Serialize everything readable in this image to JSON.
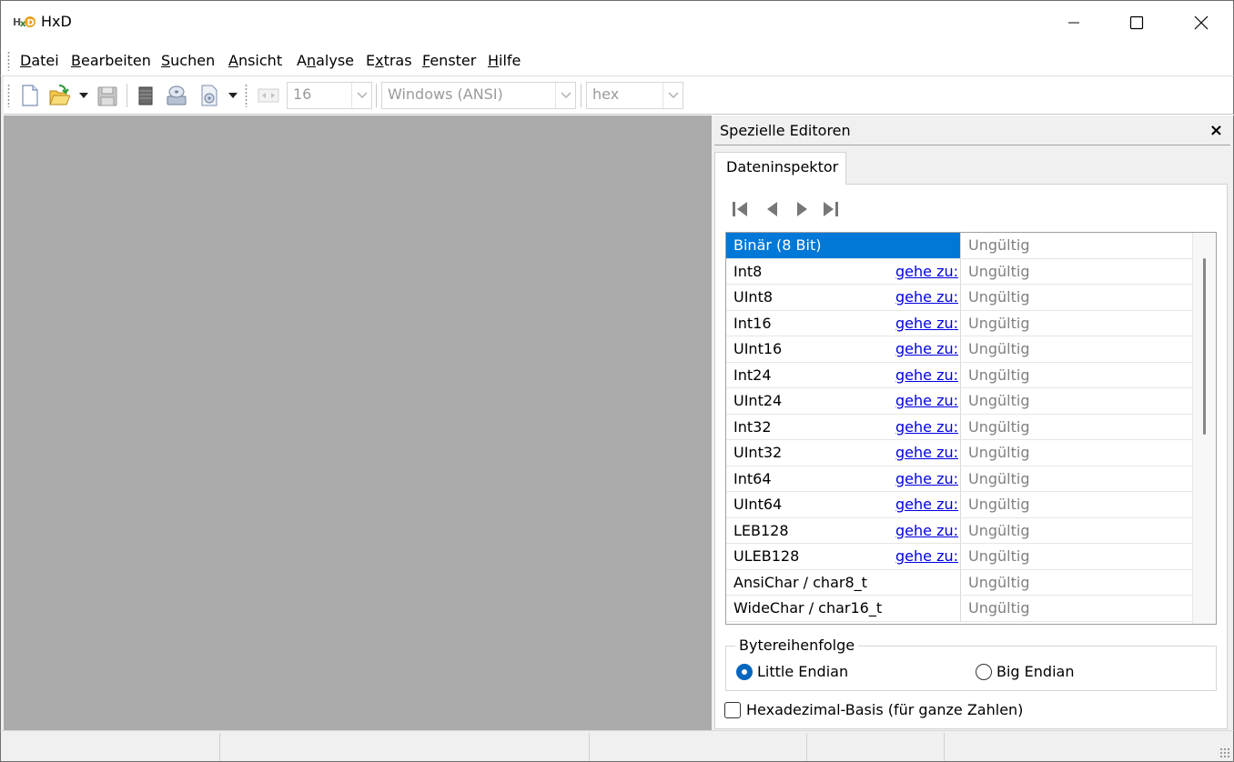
{
  "window": {
    "title": "HxD",
    "controls": [
      "minimize-icon",
      "maximize-icon",
      "close-icon"
    ]
  },
  "menu": {
    "items": [
      {
        "first": "D",
        "rest": "atei"
      },
      {
        "first": "B",
        "rest": "earbeiten"
      },
      {
        "first": "S",
        "rest": "uchen"
      },
      {
        "first": "A",
        "rest": "nsicht"
      },
      {
        "first": "An",
        "rest": "alyse",
        "underline_index": 1
      },
      {
        "first": "Ex",
        "rest": "tras"
      },
      {
        "first": "F",
        "rest": "enster"
      },
      {
        "first": "H",
        "rest": "ilfe"
      }
    ]
  },
  "toolbar": {
    "icons": [
      "new-file-icon",
      "open-file-icon",
      "save-icon",
      "ram-icon",
      "disk-icon",
      "disk-image-icon",
      "bytes-per-row-icon"
    ],
    "bytes_per_row": "16",
    "charset": "Windows (ANSI)",
    "offset_base": "hex"
  },
  "panel": {
    "title": "Spezielle Editoren",
    "close_label": "×",
    "tab": "Dateninspektor",
    "nav_icons": [
      "first-icon",
      "prev-icon",
      "next-icon",
      "last-icon"
    ],
    "link_label": "gehe zu:",
    "rows": [
      {
        "name": "Binär (8 Bit)",
        "value": "Ungültig",
        "link": false,
        "selected": true
      },
      {
        "name": "Int8",
        "value": "Ungültig",
        "link": true
      },
      {
        "name": "UInt8",
        "value": "Ungültig",
        "link": true
      },
      {
        "name": "Int16",
        "value": "Ungültig",
        "link": true
      },
      {
        "name": "UInt16",
        "value": "Ungültig",
        "link": true
      },
      {
        "name": "Int24",
        "value": "Ungültig",
        "link": true
      },
      {
        "name": "UInt24",
        "value": "Ungültig",
        "link": true
      },
      {
        "name": "Int32",
        "value": "Ungültig",
        "link": true
      },
      {
        "name": "UInt32",
        "value": "Ungültig",
        "link": true
      },
      {
        "name": "Int64",
        "value": "Ungültig",
        "link": true
      },
      {
        "name": "UInt64",
        "value": "Ungültig",
        "link": true
      },
      {
        "name": "LEB128",
        "value": "Ungültig",
        "link": true
      },
      {
        "name": "ULEB128",
        "value": "Ungültig",
        "link": true
      },
      {
        "name": "AnsiChar / char8_t",
        "value": "Ungültig",
        "link": false
      },
      {
        "name": "WideChar / char16_t",
        "value": "Ungültig",
        "link": false
      }
    ],
    "byteorder": {
      "legend": "Bytereihenfolge",
      "little": "Little Endian",
      "big": "Big Endian",
      "selected": "little"
    },
    "hex_basis": {
      "label": "Hexadezimal-Basis (für ganze Zahlen)",
      "checked": false
    }
  },
  "colors": {
    "selection": "#0078d7",
    "link": "#0000e6",
    "workspace": "#ababab"
  }
}
